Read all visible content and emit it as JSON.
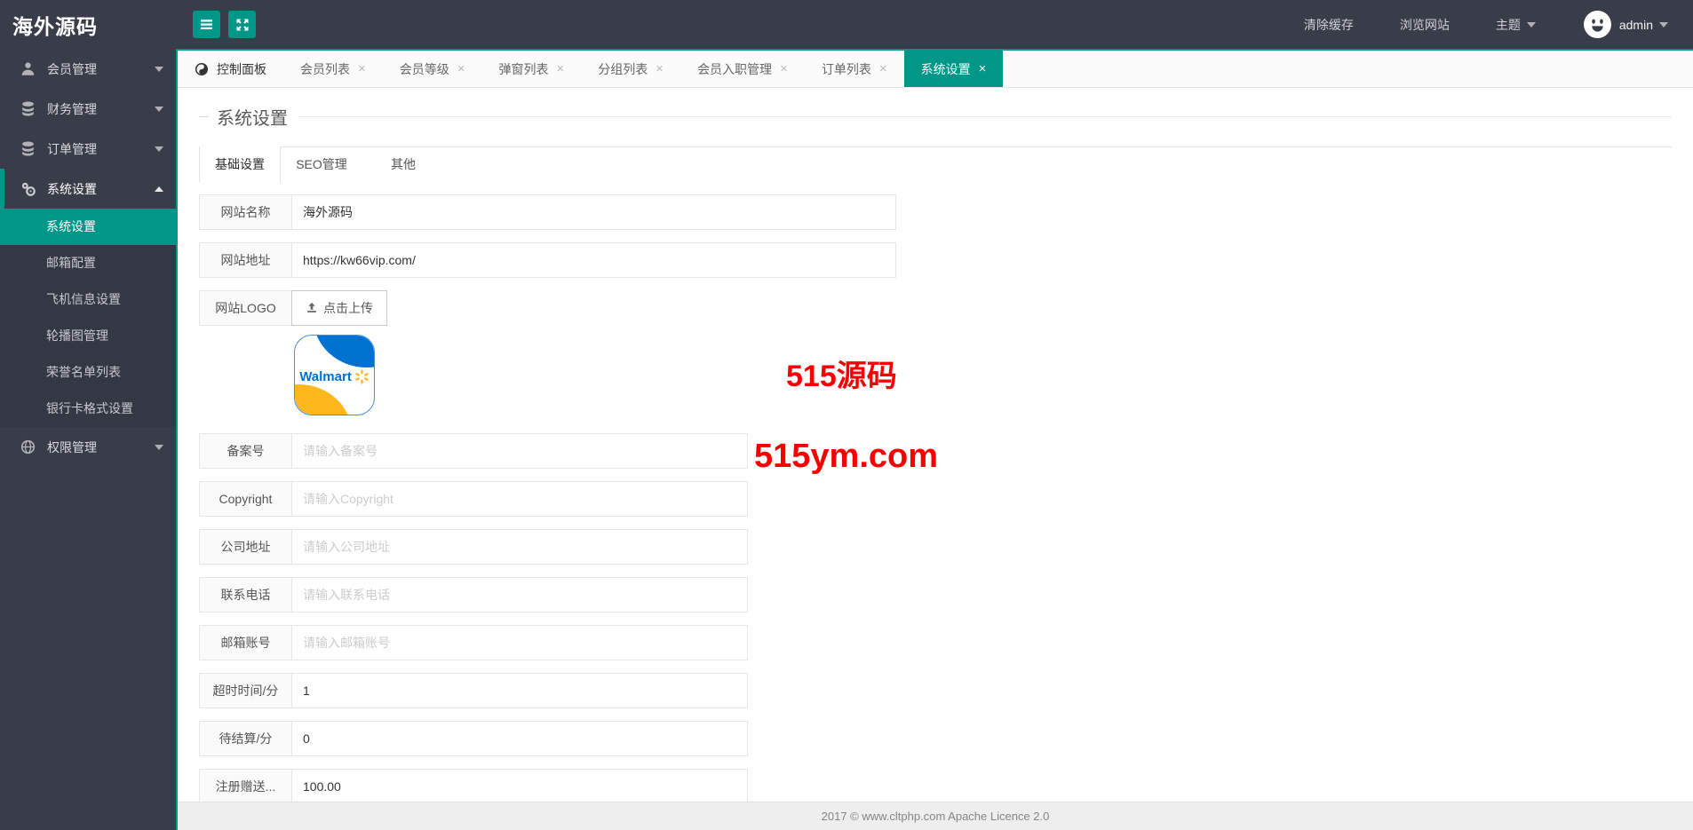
{
  "brand": {
    "logo": "海外源码"
  },
  "header": {
    "clear_cache": "清除缓存",
    "browse_site": "浏览网站",
    "theme_label": "主题",
    "username": "admin"
  },
  "tabs": [
    {
      "label": "控制面板",
      "icon": "dashboard-icon",
      "closable": false,
      "active": false
    },
    {
      "label": "会员列表",
      "closable": true,
      "active": false
    },
    {
      "label": "会员等级",
      "closable": true,
      "active": false
    },
    {
      "label": "弹窗列表",
      "closable": true,
      "active": false
    },
    {
      "label": "分组列表",
      "closable": true,
      "active": false
    },
    {
      "label": "会员入职管理",
      "closable": true,
      "active": false
    },
    {
      "label": "订单列表",
      "closable": true,
      "active": false
    },
    {
      "label": "系统设置",
      "closable": true,
      "active": true
    }
  ],
  "tab_close_glyph": "×",
  "sidebar": {
    "items": [
      {
        "label": "会员管理",
        "icon": "person-icon",
        "expanded": false
      },
      {
        "label": "财务管理",
        "icon": "database-icon",
        "expanded": false
      },
      {
        "label": "订单管理",
        "icon": "database-icon",
        "expanded": false
      },
      {
        "label": "系统设置",
        "icon": "gear-icon",
        "expanded": true,
        "children": [
          {
            "label": "系统设置",
            "active": true
          },
          {
            "label": "邮箱配置",
            "active": false
          },
          {
            "label": "飞机信息设置",
            "active": false
          },
          {
            "label": "轮播图管理",
            "active": false
          },
          {
            "label": "荣誉名单列表",
            "active": false
          },
          {
            "label": "银行卡格式设置",
            "active": false
          }
        ]
      },
      {
        "label": "权限管理",
        "icon": "globe-icon",
        "expanded": false
      }
    ]
  },
  "page": {
    "title": "系统设置",
    "inner_tabs": [
      "基础设置",
      "SEO管理",
      "其他"
    ],
    "active_inner_tab": "基础设置"
  },
  "form": {
    "rows": [
      {
        "label": "网站名称",
        "value": "海外源码"
      },
      {
        "label": "网站地址",
        "value": "https://kw66vip.com/"
      },
      {
        "label": "网站LOGO",
        "upload_button": "点击上传"
      },
      {
        "label": "备案号",
        "placeholder": "请输入备案号"
      },
      {
        "label": "Copyright",
        "placeholder": "请输入Copyright"
      },
      {
        "label": "公司地址",
        "placeholder": "请输入公司地址"
      },
      {
        "label": "联系电话",
        "placeholder": "请输入联系电话"
      },
      {
        "label": "邮箱账号",
        "placeholder": "请输入邮箱账号"
      },
      {
        "label": "超时时间/分",
        "value": "1"
      },
      {
        "label": "待结算/分",
        "value": "0"
      },
      {
        "label": "注册赠送...",
        "value": "100.00"
      }
    ],
    "logo_preview_text": "Walmart"
  },
  "watermark": {
    "line1": "515源码",
    "line2": "515ym.com",
    "color": "#f60000"
  },
  "footer": {
    "text": "2017 ©  www.cltphp.com  Apache Licence 2.0"
  },
  "colors": {
    "accent": "#009688",
    "header_bg": "#393d49",
    "watermark_red": "#f60000",
    "walmart_blue": "#0071ce",
    "walmart_yellow": "#ffb81c"
  }
}
